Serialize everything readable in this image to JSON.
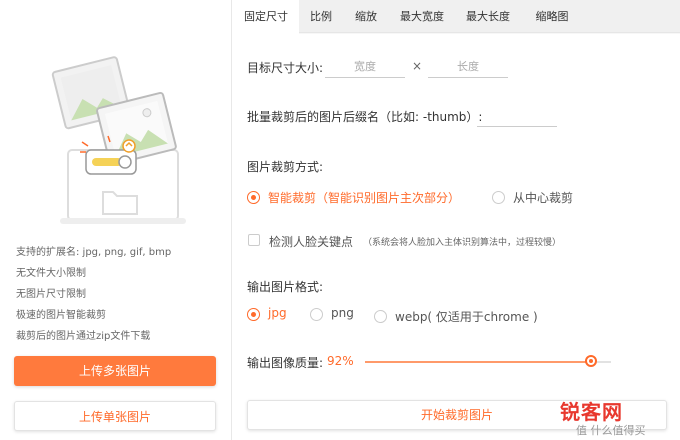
{
  "left": {
    "info_lines": [
      "支持的扩展名: jpg, png, gif, bmp",
      "无文件大小限制",
      "无图片尺寸限制",
      "极速的图片智能裁剪",
      "裁剪后的图片通过zip文件下载"
    ],
    "upload_multi_label": "上传多张图片",
    "upload_single_label": "上传单张图片"
  },
  "tabs": [
    "固定尺寸",
    "比例",
    "缩放",
    "最大宽度",
    "最大长度",
    "缩略图"
  ],
  "active_tab": 0,
  "form": {
    "target_size_label": "目标尺寸大小:",
    "width_placeholder": "宽度",
    "times_sign": "×",
    "height_placeholder": "长度",
    "suffix_label": "批量裁剪后的图片后缀名（比如: -thumb）:",
    "suffix_value": "",
    "crop_mode_label": "图片裁剪方式:",
    "crop_modes": [
      {
        "label": "智能裁剪（智能识别图片主次部分）",
        "selected": true
      },
      {
        "label": "从中心裁剪",
        "selected": false
      }
    ],
    "face_detect_label": "检测人脸关键点",
    "face_detect_checked": false,
    "face_detect_hint": "（系统会将人脸加入主体识别算法中，过程较慢）",
    "output_format_label": "输出图片格式:",
    "formats": [
      {
        "label": "jpg",
        "selected": true
      },
      {
        "label": "png",
        "selected": false
      },
      {
        "label": "webp( 仅适用于chrome )",
        "selected": false
      }
    ],
    "quality_label": "输出图像质量:",
    "quality_value": "92%",
    "quality_fraction": 0.92,
    "start_button_label": "开始裁剪图片"
  },
  "watermark": {
    "main": "锐客网",
    "sub": "值 什么值得买"
  },
  "colors": {
    "accent": "#ff6a2a",
    "primary_button": "#ff7a3d",
    "watermark_red": "#e8382e"
  }
}
